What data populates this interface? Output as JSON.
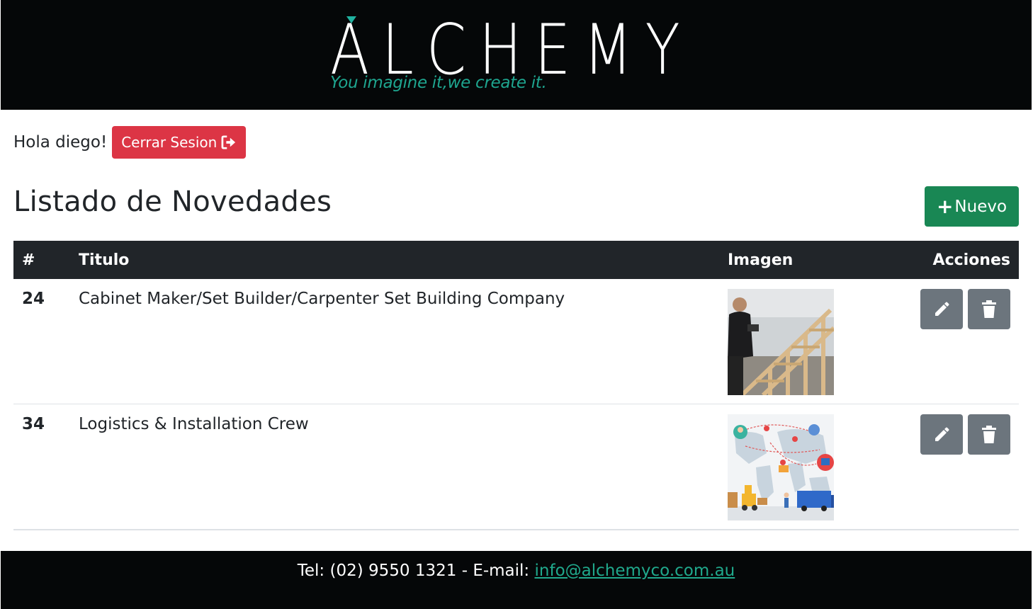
{
  "header": {
    "brand": "ALCHEMY",
    "tagline": "You imagine it,we create it.",
    "accent_color": "#20b2a0"
  },
  "session": {
    "greeting": "Hola diego!",
    "logout_label": "Cerrar Sesion",
    "logout_icon": "sign-out-icon"
  },
  "page": {
    "title": "Listado de Novedades",
    "new_label": "Nuevo",
    "new_icon": "plus-icon"
  },
  "table": {
    "headers": {
      "id": "#",
      "title": "Titulo",
      "image": "Imagen",
      "actions": "Acciones"
    },
    "rows": [
      {
        "id": "24",
        "title": "Cabinet Maker/Set Builder/Carpenter Set Building Company",
        "image": "carpenter-building-stairs-photo"
      },
      {
        "id": "34",
        "title": "Logistics & Installation Crew",
        "image": "logistics-world-map-illustration"
      }
    ],
    "edit_icon": "pencil-icon",
    "delete_icon": "trash-icon"
  },
  "footer": {
    "contact_text": "Tel: (02) 9550 1321 - E-mail: ",
    "email": "info@alchemyco.com.au"
  },
  "colors": {
    "danger": "#dc3545",
    "success": "#198754",
    "secondary": "#6c757d",
    "dark": "#212529"
  }
}
